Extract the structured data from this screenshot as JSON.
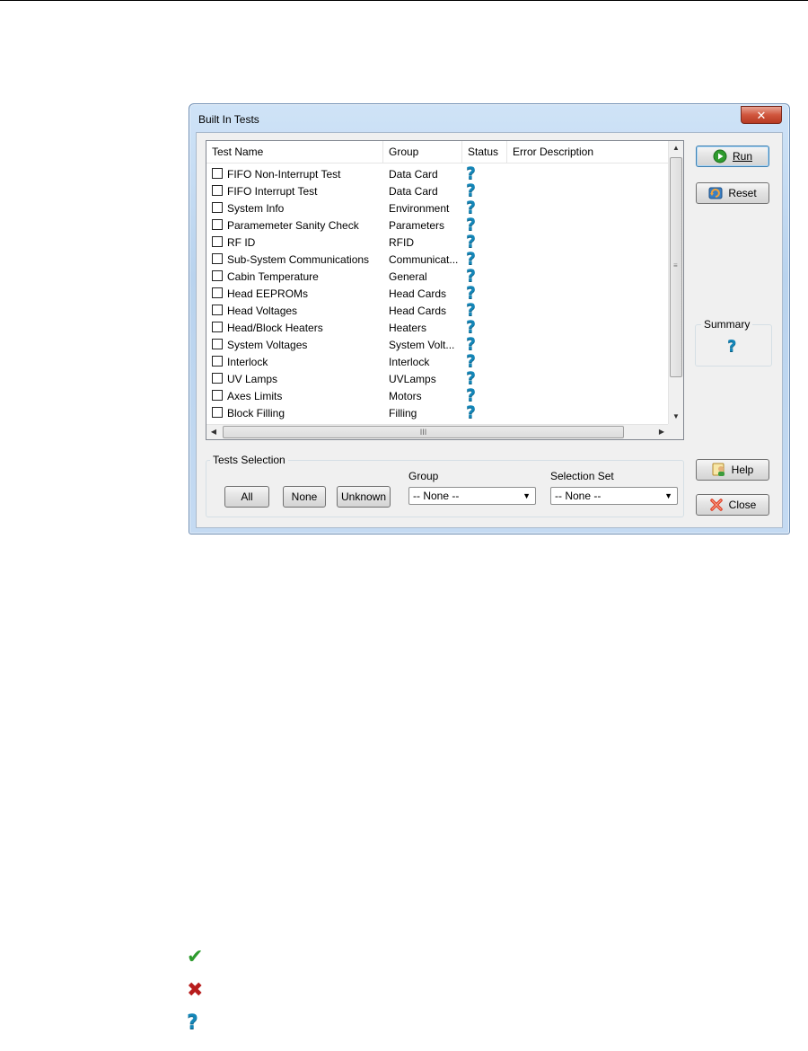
{
  "window": {
    "title": "Built In Tests",
    "close_glyph": "✕"
  },
  "list": {
    "columns": {
      "name": "Test Name",
      "group": "Group",
      "status": "Status",
      "error": "Error Description"
    },
    "status_glyph": "?",
    "rows": [
      {
        "name": "FIFO Non-Interrupt Test",
        "group": "Data Card"
      },
      {
        "name": "FIFO Interrupt Test",
        "group": "Data Card"
      },
      {
        "name": "System Info",
        "group": "Environment"
      },
      {
        "name": "Paramemeter Sanity Check",
        "group": "Parameters"
      },
      {
        "name": "RF ID",
        "group": "RFID"
      },
      {
        "name": "Sub-System Communications",
        "group": "Communicat..."
      },
      {
        "name": "Cabin Temperature",
        "group": "General"
      },
      {
        "name": "Head EEPROMs",
        "group": "Head Cards"
      },
      {
        "name": "Head Voltages",
        "group": "Head Cards"
      },
      {
        "name": "Head/Block Heaters",
        "group": "Heaters"
      },
      {
        "name": "System Voltages",
        "group": "System Volt..."
      },
      {
        "name": "Interlock",
        "group": "Interlock"
      },
      {
        "name": "UV Lamps",
        "group": "UVLamps"
      },
      {
        "name": "Axes Limits",
        "group": "Motors"
      },
      {
        "name": "Block Filling",
        "group": "Filling"
      }
    ],
    "scroll_grip": "≡",
    "hscroll_grip": "III",
    "arrow_up": "▲",
    "arrow_down": "▼",
    "arrow_left": "◀",
    "arrow_right": "▶"
  },
  "buttons": {
    "run": "Run",
    "reset": "Reset",
    "help": "Help",
    "close": "Close"
  },
  "summary": {
    "label": "Summary",
    "glyph": "?"
  },
  "tests_selection": {
    "label": "Tests Selection",
    "all": "All",
    "none": "None",
    "unknown": "Unknown",
    "group_label": "Group",
    "group_value": "-- None --",
    "set_label": "Selection Set",
    "set_value": "-- None --",
    "caret": "▼"
  },
  "legend": {
    "pass": "✔",
    "fail": "✖",
    "unknown": "?"
  },
  "colors": {
    "status_unknown": "#1486b8",
    "pass": "#2e9b2e",
    "fail": "#b71c1c"
  }
}
